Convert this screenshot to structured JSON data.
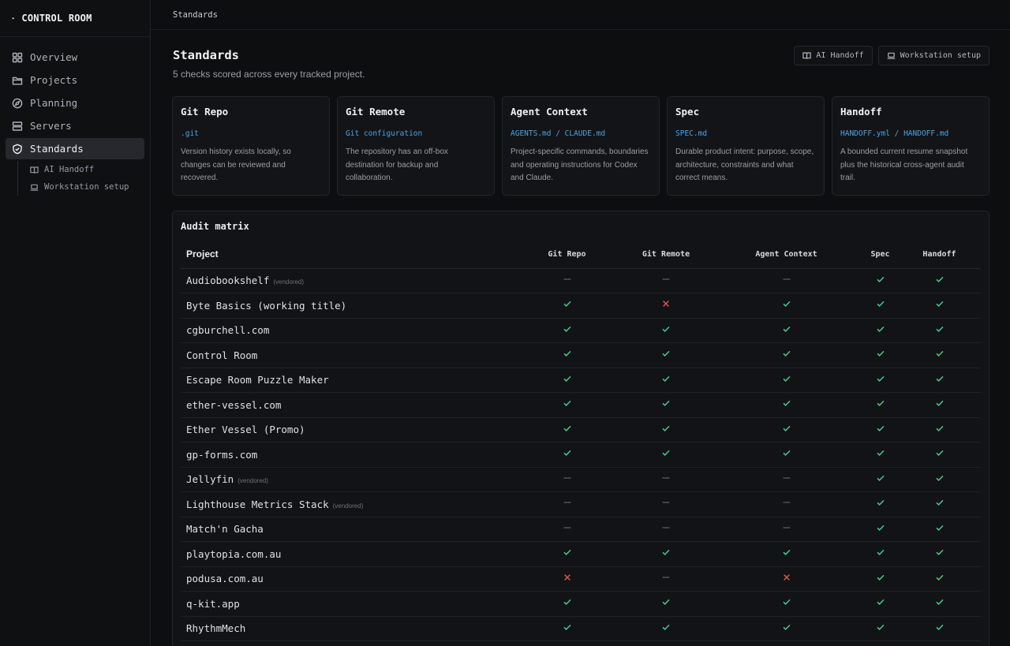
{
  "app": {
    "title": "CONTROL ROOM"
  },
  "sidebar": {
    "items": [
      {
        "label": "Overview",
        "icon": "grid-icon",
        "active": false
      },
      {
        "label": "Projects",
        "icon": "folder-icon",
        "active": false
      },
      {
        "label": "Planning",
        "icon": "compass-icon",
        "active": false
      },
      {
        "label": "Servers",
        "icon": "server-icon",
        "active": false
      },
      {
        "label": "Standards",
        "icon": "shield-icon",
        "active": true
      }
    ],
    "subitems": [
      {
        "label": "AI Handoff",
        "icon": "book-icon"
      },
      {
        "label": "Workstation setup",
        "icon": "laptop-icon"
      }
    ]
  },
  "breadcrumb": "Standards",
  "header": {
    "title": "Standards",
    "subtitle": "5 checks scored across every tracked project.",
    "buttons": [
      {
        "label": "AI Handoff",
        "icon": "book-icon"
      },
      {
        "label": "Workstation setup",
        "icon": "laptop-icon"
      }
    ]
  },
  "cards": [
    {
      "title": "Git Repo",
      "file": ".git",
      "desc": "Version history exists locally, so changes can be reviewed and recovered."
    },
    {
      "title": "Git Remote",
      "file": "Git configuration",
      "desc": "The repository has an off-box destination for backup and collaboration."
    },
    {
      "title": "Agent Context",
      "file": "AGENTS.md / CLAUDE.md",
      "desc": "Project-specific commands, boundaries and operating instructions for Codex and Claude."
    },
    {
      "title": "Spec",
      "file": "SPEC.md",
      "desc": "Durable product intent: purpose, scope, architecture, constraints and what correct means."
    },
    {
      "title": "Handoff",
      "file": "HANDOFF.yml / HANDOFF.md",
      "desc": "A bounded current resume snapshot plus the historical cross-agent audit trail."
    }
  ],
  "matrix": {
    "title": "Audit matrix",
    "columns": [
      "Project",
      "Git Repo",
      "Git Remote",
      "Agent Context",
      "Spec",
      "Handoff"
    ],
    "vendored_label": "(vendored)",
    "status_colors": {
      "pass": "#45c98a",
      "fail": "#e0524c",
      "na": "#4e5158"
    },
    "rows": [
      {
        "name": "Audiobookshelf",
        "vendored": true,
        "checks": [
          "na",
          "na",
          "na",
          "pass",
          "pass"
        ]
      },
      {
        "name": "Byte Basics (working title)",
        "vendored": false,
        "checks": [
          "pass",
          "fail",
          "pass",
          "pass",
          "pass"
        ]
      },
      {
        "name": "cgburchell.com",
        "vendored": false,
        "checks": [
          "pass",
          "pass",
          "pass",
          "pass",
          "pass"
        ]
      },
      {
        "name": "Control Room",
        "vendored": false,
        "checks": [
          "pass",
          "pass",
          "pass",
          "pass",
          "pass"
        ]
      },
      {
        "name": "Escape Room Puzzle Maker",
        "vendored": false,
        "checks": [
          "pass",
          "pass",
          "pass",
          "pass",
          "pass"
        ]
      },
      {
        "name": "ether-vessel.com",
        "vendored": false,
        "checks": [
          "pass",
          "pass",
          "pass",
          "pass",
          "pass"
        ]
      },
      {
        "name": "Ether Vessel (Promo)",
        "vendored": false,
        "checks": [
          "pass",
          "pass",
          "pass",
          "pass",
          "pass"
        ]
      },
      {
        "name": "gp-forms.com",
        "vendored": false,
        "checks": [
          "pass",
          "pass",
          "pass",
          "pass",
          "pass"
        ]
      },
      {
        "name": "Jellyfin",
        "vendored": true,
        "checks": [
          "na",
          "na",
          "na",
          "pass",
          "pass"
        ]
      },
      {
        "name": "Lighthouse Metrics Stack",
        "vendored": true,
        "checks": [
          "na",
          "na",
          "na",
          "pass",
          "pass"
        ]
      },
      {
        "name": "Match'n Gacha",
        "vendored": false,
        "checks": [
          "na",
          "na",
          "na",
          "pass",
          "pass"
        ]
      },
      {
        "name": "playtopia.com.au",
        "vendored": false,
        "checks": [
          "pass",
          "pass",
          "pass",
          "pass",
          "pass"
        ]
      },
      {
        "name": "podusa.com.au",
        "vendored": false,
        "checks": [
          "fail",
          "na",
          "fail",
          "pass",
          "pass"
        ]
      },
      {
        "name": "q-kit.app",
        "vendored": false,
        "checks": [
          "pass",
          "pass",
          "pass",
          "pass",
          "pass"
        ]
      },
      {
        "name": "RhythmMech",
        "vendored": false,
        "checks": [
          "pass",
          "pass",
          "pass",
          "pass",
          "pass"
        ]
      }
    ]
  }
}
